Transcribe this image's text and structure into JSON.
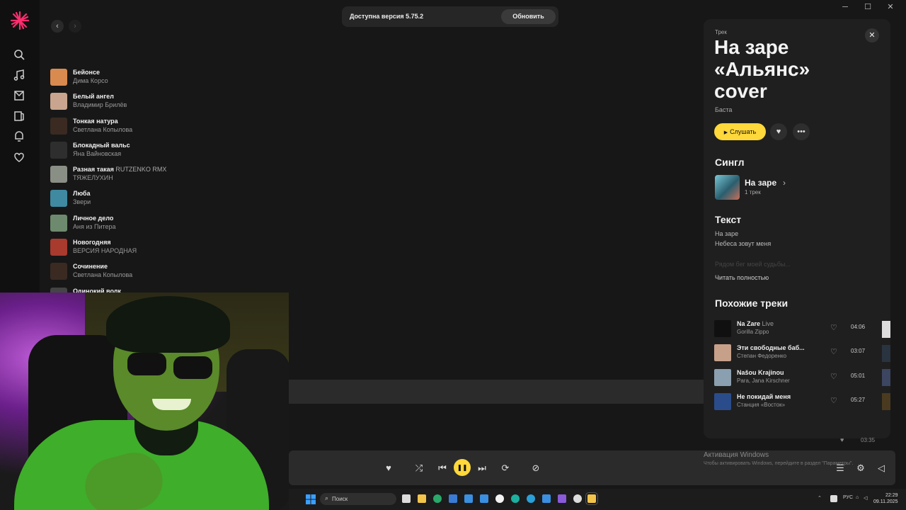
{
  "window": {
    "controls": [
      "─",
      "☐",
      "✕"
    ]
  },
  "nav": {
    "back": "‹",
    "forward": "›"
  },
  "rail": {
    "icons": [
      "search-icon",
      "music-note-icon",
      "collection-icon",
      "library-icon",
      "podcast-icon",
      "heart-icon"
    ]
  },
  "update_banner": {
    "text": "Доступна версия 5.75.2",
    "button": "Обновить"
  },
  "tracklist": [
    {
      "title": "Бейонсе",
      "version": "",
      "artist": "Дима Корсо",
      "cover": "#d98a4f"
    },
    {
      "title": "Белый ангел",
      "version": "",
      "artist": "Владимир Брилёв",
      "cover": "#c9a58f"
    },
    {
      "title": "Тонкая натура",
      "version": "",
      "artist": "Светлана Копылова",
      "cover": "#3a2a22"
    },
    {
      "title": "Блокадный вальс",
      "version": "",
      "artist": "Яна Вайновская",
      "cover": "#2e2e2e"
    },
    {
      "title": "Разная такая",
      "version": "RUTZENKO RMX",
      "artist": "ТЯЖЕЛУХИН",
      "cover": "#8a8f86"
    },
    {
      "title": "Люба",
      "version": "",
      "artist": "Звери",
      "cover": "#3f8aa0"
    },
    {
      "title": "Личное дело",
      "version": "",
      "artist": "Аня из Питера",
      "cover": "#6e8a6e"
    },
    {
      "title": "Новогодняя",
      "version": "",
      "artist": "ВЕРСИЯ НАРОДНАЯ",
      "cover": "#a83a2e"
    },
    {
      "title": "Сочинение",
      "version": "",
      "artist": "Светлана Копылова",
      "cover": "#3a2a22"
    },
    {
      "title": "Одинокий волк",
      "version": "",
      "artist": "",
      "cover": "#444444"
    }
  ],
  "panel": {
    "kind": "Трек",
    "title": "На заре «Альянс» cover",
    "artist": "Баста",
    "listen_label": "Слушать",
    "single_heading": "Сингл",
    "single": {
      "title": "На заре",
      "count": "1 трек"
    },
    "lyrics_heading": "Текст",
    "lyrics": [
      "На заре",
      "Небеса зовут меня",
      "Рядом бег моей судьбы..."
    ],
    "read_all": "Читать полностью",
    "similar_heading": "Похожие треки",
    "similar": [
      {
        "title": "Na Zare",
        "version": "Live",
        "artist": "Gorilla Zippo",
        "duration": "04:06",
        "cover": "#101010"
      },
      {
        "title": "Эти свободные баб...",
        "version": "",
        "artist": "Степан Федоренко",
        "duration": "03:07",
        "cover": "#c7a08a"
      },
      {
        "title": "Našou Krajinou",
        "version": "",
        "artist": "Para, Jana Kirschner",
        "duration": "05:01",
        "cover": "#8aa0b0"
      },
      {
        "title": "Не покидай меня",
        "version": "",
        "artist": "Станция «Восток»",
        "duration": "05:27",
        "cover": "#2a4c8a"
      }
    ]
  },
  "player": {
    "ghost_duration": "03:35"
  },
  "activation": {
    "title": "Активация Windows",
    "subtitle": "Чтобы активировать Windows, перейдите в раздел \"Параметры\"."
  },
  "taskbar": {
    "search_placeholder": "Поиск",
    "lang": "РУС",
    "time": "22:29",
    "date": "09.11.2025"
  },
  "colors": {
    "accent": "#ffd83b",
    "background": "#171717",
    "panel": "#1f1f1f"
  }
}
